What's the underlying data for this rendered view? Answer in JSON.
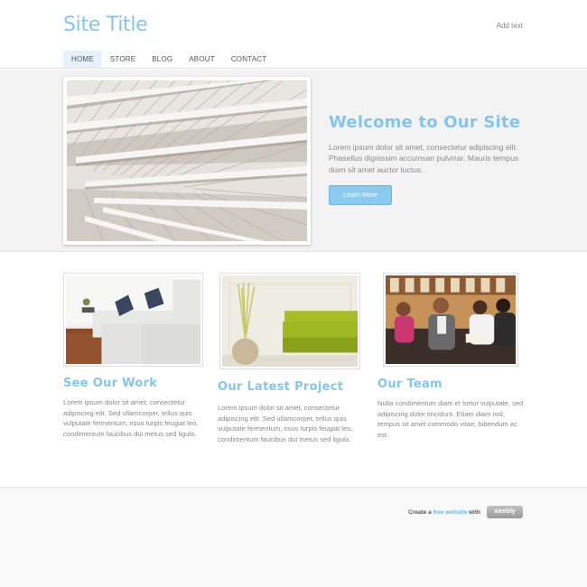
{
  "header": {
    "site_title": "Site Title",
    "add_text": "Add text",
    "nav": [
      {
        "label": "HOME",
        "active": true
      },
      {
        "label": "STORE",
        "active": false
      },
      {
        "label": "BLOG",
        "active": false
      },
      {
        "label": "ABOUT",
        "active": false
      },
      {
        "label": "CONTACT",
        "active": false
      }
    ]
  },
  "hero": {
    "title": "Welcome to Our Site",
    "text": "Lorem ipsum dolor sit amet, consectetur adipiscing elit. Phasellus dignissim accumsan pulvinar. Mauris tempus diam sit amet auctor luctus.",
    "button_label": "Learn More"
  },
  "columns": [
    {
      "title": "See Our Work",
      "text": "Lorem ipsum dolor sit amet, consectetur adipiscing elit. Sed ullamcorper, tellus quis vulputate fermentum, risus turpis feugiat leo, condimentum faucibus dui metus sed ligula."
    },
    {
      "title": "Our Latest Project",
      "text": "Lorem ipsum dolor sit amet, consectetur adipiscing elit. Sed ullamcorper, tellus quis vulputate fermentum, risus turpis feugiat leo, condimentum faucibus dui metus sed ligula."
    },
    {
      "title": "Our Team",
      "text": "Nulla condimentum diam et tortor vulputate, sed adipiscing dolor tincidunt. Etiam diam nisl, tempus sit amet commodo vitae, bibendum ac est."
    }
  ],
  "footer": {
    "prefix": "Create a",
    "link": "free website",
    "suffix": "with",
    "badge": "weebly"
  },
  "colors": {
    "accent": "#86c5ea",
    "button": "#8ccaf0",
    "hero_bg": "#f3f3f3"
  }
}
